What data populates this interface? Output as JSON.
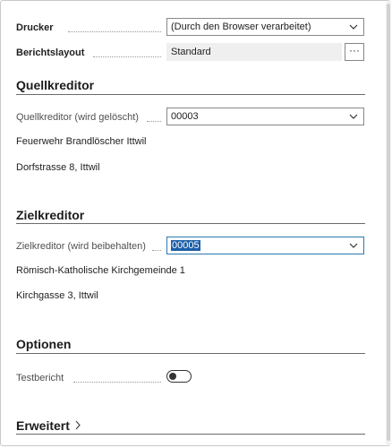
{
  "report": {
    "drucker": {
      "label": "Drucker",
      "value": "(Durch den Browser verarbeitet)"
    },
    "layout": {
      "label": "Berichtslayout",
      "value": "Standard",
      "more": "···"
    }
  },
  "source": {
    "title": "Quellkreditor",
    "field": {
      "label": "Quellkreditor (wird gelöscht)",
      "value": "00003"
    },
    "name": "Feuerwehr Brandlöscher Ittwil",
    "address": "Dorfstrasse 8, Ittwil"
  },
  "target": {
    "title": "Zielkreditor",
    "field": {
      "label": "Zielkreditor (wird beibehalten)",
      "value": "00005"
    },
    "name": "Römisch-Katholische  Kirchgemeinde 1",
    "address": "Kirchgasse 3, Ittwil"
  },
  "options": {
    "title": "Optionen",
    "testbericht": {
      "label": "Testbericht",
      "on": false
    }
  },
  "advanced": {
    "title": "Erweitert",
    "chevron": "chevron-right-icon"
  },
  "colors": {
    "accent": "#1d5fa8",
    "focus_border": "#2a7ab0",
    "divider": "#6b6b6b"
  }
}
